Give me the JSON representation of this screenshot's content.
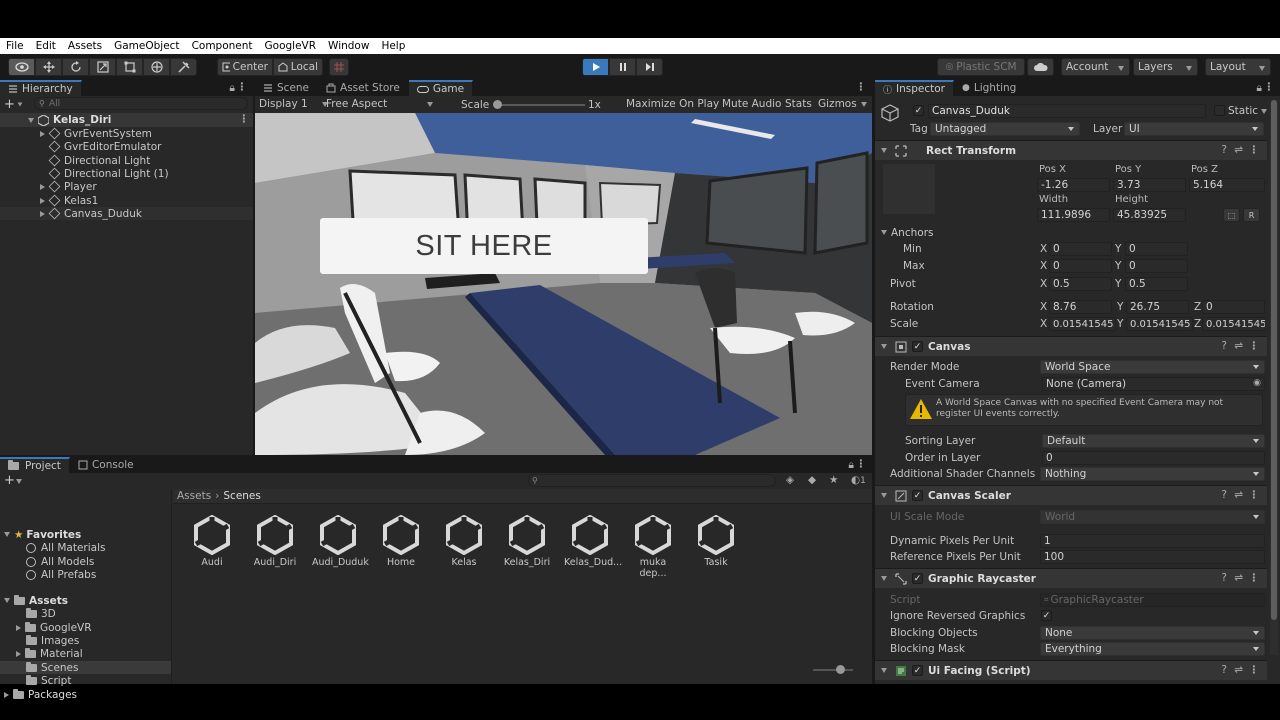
{
  "menu": [
    "File",
    "Edit",
    "Assets",
    "GameObject",
    "Component",
    "GoogleVR",
    "Window",
    "Help"
  ],
  "toolbar": {
    "center_label": "Center",
    "local_label": "Local",
    "plastic_label": "Plastic SCM",
    "account_label": "Account",
    "layers_label": "Layers",
    "layout_label": "Layout"
  },
  "hierarchy": {
    "tab": "Hierarchy",
    "search_placeholder": "All",
    "scene": "Kelas_Diri",
    "items": [
      "GvrEventSystem",
      "GvrEditorEmulator",
      "Directional Light",
      "Directional Light (1)",
      "Player",
      "Kelas1",
      "Canvas_Duduk"
    ]
  },
  "game": {
    "tabs": [
      "Scene",
      "Asset Store",
      "Game"
    ],
    "display": "Display 1",
    "aspect": "Free Aspect",
    "scale_label": "Scale",
    "scale_value": "1x",
    "maximize": "Maximize On Play",
    "mute": "Mute Audio",
    "stats": "Stats",
    "gizmos": "Gizmos",
    "sit_text": "SIT HERE"
  },
  "project": {
    "tabs": [
      "Project",
      "Console"
    ],
    "favorites_label": "Favorites",
    "favorites": [
      "All Materials",
      "All Models",
      "All Prefabs"
    ],
    "assets_label": "Assets",
    "folders": [
      "3D",
      "GoogleVR",
      "Images",
      "Material",
      "Scenes",
      "Script"
    ],
    "packages_label": "Packages",
    "breadcrumb": [
      "Assets",
      "Scenes"
    ],
    "badge_count": "1",
    "scenes": [
      "Audi",
      "Audi_Diri",
      "Audi_Duduk",
      "Home",
      "Kelas",
      "Kelas_Diri",
      "Kelas_Dud...",
      "muka dep...",
      "Tasik"
    ]
  },
  "inspector": {
    "tabs": [
      "Inspector",
      "Lighting"
    ],
    "object_name": "Canvas_Duduk",
    "static_label": "Static",
    "tag_label": "Tag",
    "tag_value": "Untagged",
    "layer_label": "Layer",
    "layer_value": "UI",
    "rect": {
      "title": "Rect Transform",
      "posx_label": "Pos X",
      "posy_label": "Pos Y",
      "posz_label": "Pos Z",
      "posx": "-1.26",
      "posy": "3.73",
      "posz": "5.164",
      "width_label": "Width",
      "height_label": "Height",
      "width": "111.9896",
      "height": "45.83925",
      "r_btn": "R",
      "anchors_label": "Anchors",
      "min_label": "Min",
      "max_label": "Max",
      "min_x": "0",
      "min_y": "0",
      "max_x": "0",
      "max_y": "0",
      "pivot_label": "Pivot",
      "pivot_x": "0.5",
      "pivot_y": "0.5",
      "rotation_label": "Rotation",
      "rot_x": "8.76",
      "rot_y": "26.75",
      "rot_z": "0",
      "scale_label": "Scale",
      "scale_x": "0.01541545",
      "scale_y": "0.01541545",
      "scale_z": "0.01541545",
      "x": "X",
      "y": "Y",
      "z": "Z"
    },
    "canvas": {
      "title": "Canvas",
      "render_mode_label": "Render Mode",
      "render_mode": "World Space",
      "event_camera_label": "Event Camera",
      "event_camera": "None (Camera)",
      "warning": "A World Space Canvas with no specified Event Camera may not register UI events correctly.",
      "sorting_layer_label": "Sorting Layer",
      "sorting_layer": "Default",
      "order_label": "Order in Layer",
      "order": "0",
      "shader_label": "Additional Shader Channels",
      "shader": "Nothing"
    },
    "scaler": {
      "title": "Canvas Scaler",
      "scale_mode_label": "UI Scale Mode",
      "scale_mode": "World",
      "dpu_label": "Dynamic Pixels Per Unit",
      "dpu": "1",
      "rppu_label": "Reference Pixels Per Unit",
      "rppu": "100"
    },
    "raycaster": {
      "title": "Graphic Raycaster",
      "script_label": "Script",
      "script": "GraphicRaycaster",
      "ignore_label": "Ignore Reversed Graphics",
      "blocking_objects_label": "Blocking Objects",
      "blocking_objects": "None",
      "blocking_mask_label": "Blocking Mask",
      "blocking_mask": "Everything"
    },
    "facing": {
      "title": "Ui Facing (Script)"
    }
  }
}
